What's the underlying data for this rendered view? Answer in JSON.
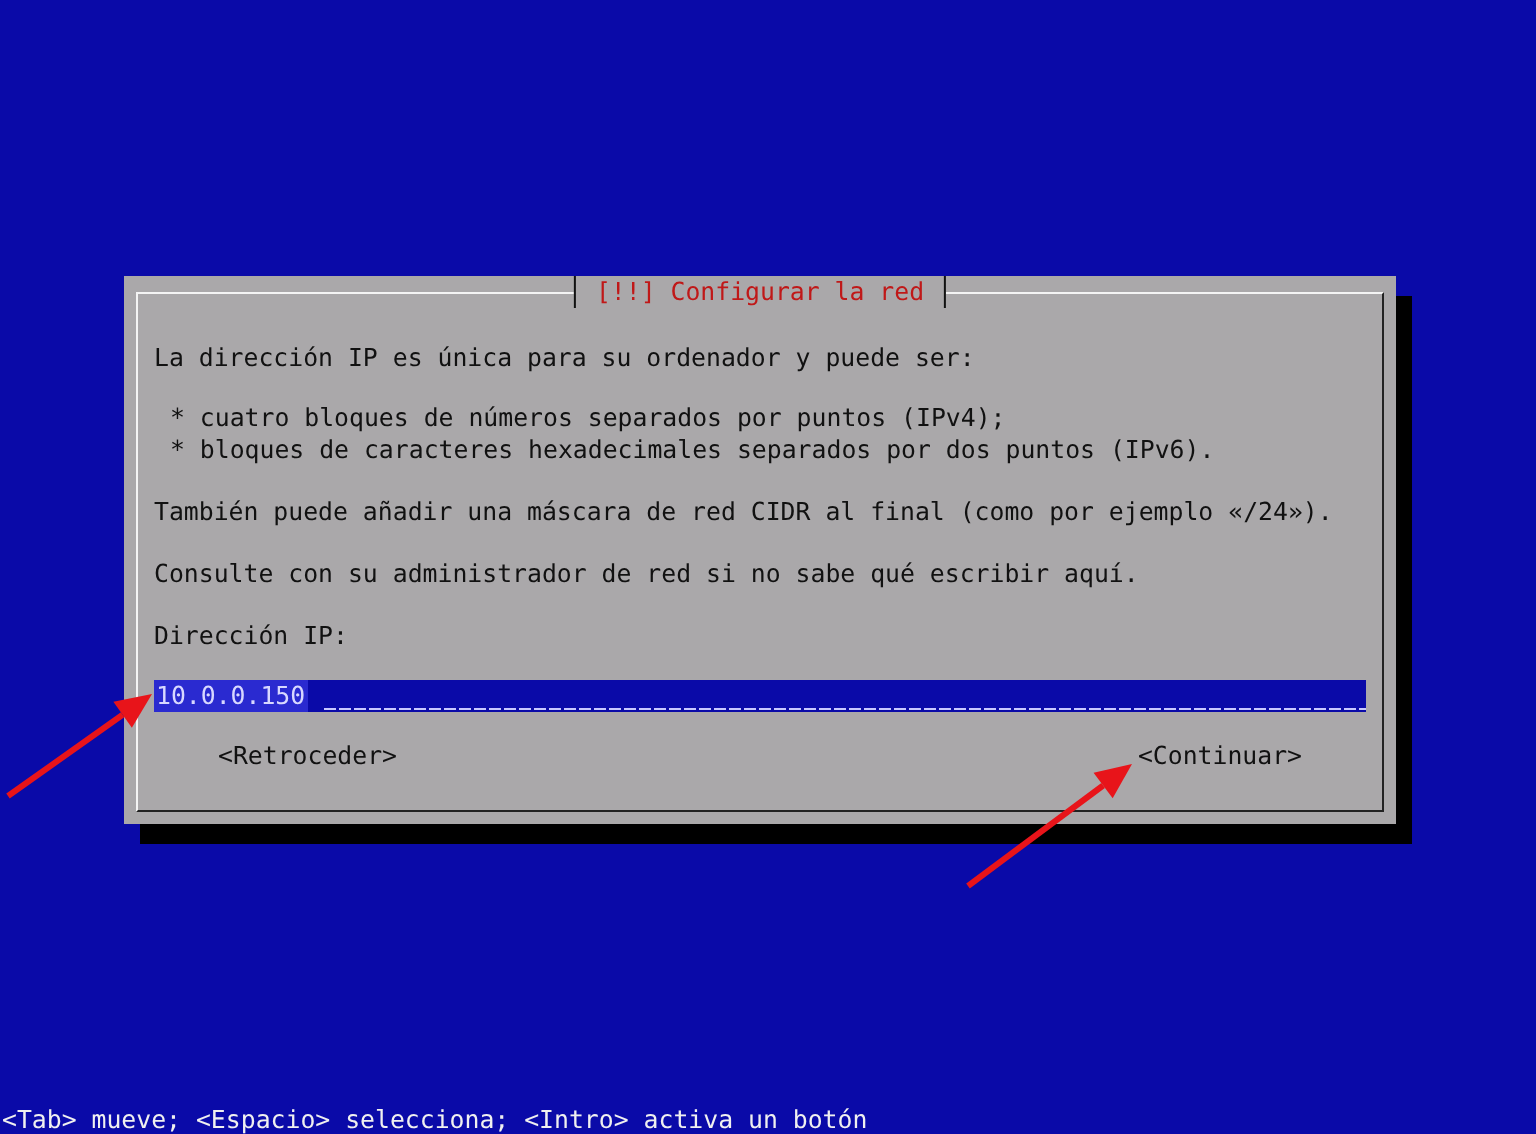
{
  "dialog": {
    "title": "[!!] Configurar la red",
    "intro": "La dirección IP es única para su ordenador y puede ser:",
    "bullets": [
      "* cuatro bloques de números separados por puntos (IPv4);",
      "* bloques de caracteres hexadecimales separados por dos puntos (IPv6)."
    ],
    "paragraphs": [
      "También puede añadir una máscara de red CIDR al final (como por ejemplo «/24»).",
      "Consulte con su administrador de red si no sabe qué escribir aquí."
    ],
    "field": {
      "label": "Dirección IP:",
      "value": "10.0.0.150"
    },
    "buttons": [
      {
        "label": "<Retroceder>"
      },
      {
        "label": "<Continuar>"
      }
    ]
  },
  "help_line": "<Tab> mueve; <Espacio> selecciona; <Intro> activa un botón"
}
